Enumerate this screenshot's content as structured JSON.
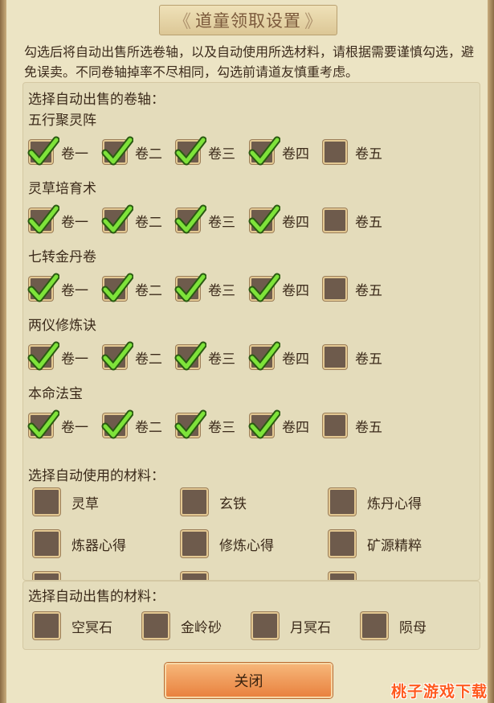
{
  "title": "道童领取设置",
  "title_arrow_left": "《",
  "title_arrow_right": "》",
  "description": "勾选后将自动出售所选卷轴，以及自动使用所选材料，请根据需要谨慎勾选，避免误卖。不同卷轴掉率不尽相同，勾选前请道友慎重考虑。",
  "scroll_section_label": "选择自动出售的卷轴：",
  "scroll_groups": [
    {
      "name": "五行聚灵阵",
      "options": [
        {
          "label": "卷一",
          "checked": true
        },
        {
          "label": "卷二",
          "checked": true
        },
        {
          "label": "卷三",
          "checked": true
        },
        {
          "label": "卷四",
          "checked": true
        },
        {
          "label": "卷五",
          "checked": false
        }
      ]
    },
    {
      "name": "灵草培育术",
      "options": [
        {
          "label": "卷一",
          "checked": true
        },
        {
          "label": "卷二",
          "checked": true
        },
        {
          "label": "卷三",
          "checked": true
        },
        {
          "label": "卷四",
          "checked": true
        },
        {
          "label": "卷五",
          "checked": false
        }
      ]
    },
    {
      "name": "七转金丹卷",
      "options": [
        {
          "label": "卷一",
          "checked": true
        },
        {
          "label": "卷二",
          "checked": true
        },
        {
          "label": "卷三",
          "checked": true
        },
        {
          "label": "卷四",
          "checked": true
        },
        {
          "label": "卷五",
          "checked": false
        }
      ]
    },
    {
      "name": "两仪修炼诀",
      "options": [
        {
          "label": "卷一",
          "checked": true
        },
        {
          "label": "卷二",
          "checked": true
        },
        {
          "label": "卷三",
          "checked": true
        },
        {
          "label": "卷四",
          "checked": true
        },
        {
          "label": "卷五",
          "checked": false
        }
      ]
    },
    {
      "name": "本命法宝",
      "options": [
        {
          "label": "卷一",
          "checked": true
        },
        {
          "label": "卷二",
          "checked": true
        },
        {
          "label": "卷三",
          "checked": true
        },
        {
          "label": "卷四",
          "checked": true
        },
        {
          "label": "卷五",
          "checked": false
        }
      ]
    }
  ],
  "use_section_label": "选择自动使用的材料：",
  "use_materials": [
    {
      "label": "灵草",
      "checked": false
    },
    {
      "label": "玄铁",
      "checked": false
    },
    {
      "label": "炼丹心得",
      "checked": false
    },
    {
      "label": "炼器心得",
      "checked": false
    },
    {
      "label": "修炼心得",
      "checked": false
    },
    {
      "label": "矿源精粹",
      "checked": false
    }
  ],
  "sell_section_label": "选择自动出售的材料：",
  "sell_materials": [
    {
      "label": "空冥石",
      "checked": false
    },
    {
      "label": "金岭砂",
      "checked": false
    },
    {
      "label": "月冥石",
      "checked": false
    },
    {
      "label": "陨母",
      "checked": false
    }
  ],
  "close_label": "关闭",
  "watermark": "桃子游戏下载",
  "colors": {
    "background": "#ece4c4",
    "panel": "#e4dcbb",
    "checkbox_fill": "#6e5b4c",
    "checkmark": "#7ee33a",
    "button": "#e9823f",
    "watermark": "#ff5a1f"
  }
}
